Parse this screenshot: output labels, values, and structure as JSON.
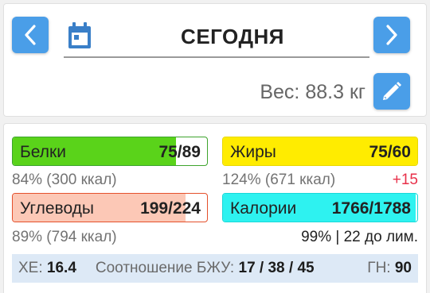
{
  "header": {
    "date_title": "СЕГОДНЯ",
    "weight_label": "Вес:",
    "weight_value": "88.3",
    "weight_unit": "кг"
  },
  "macros": {
    "protein": {
      "name": "Белки",
      "value": "75/89",
      "progress": 0.84,
      "percent_text": "84% (300 ккал)"
    },
    "fat": {
      "name": "Жиры",
      "value": "75/60",
      "progress": 1.0,
      "percent_text": "124% (671 ккал)",
      "over_text": "+15"
    },
    "carbs": {
      "name": "Углеводы",
      "value": "199/224",
      "progress": 0.89,
      "percent_text": "89% (794 ккал)"
    },
    "calories": {
      "name": "Калории",
      "value": "1766/1788",
      "progress": 0.99,
      "percent_text": "99% | 22 до лим."
    }
  },
  "summary": {
    "xe_label": "ХЕ:",
    "xe_value": "16.4",
    "ratio_label": "Соотношение БЖУ:",
    "ratio_value": "17 / 38 / 45",
    "gn_label": "ГН:",
    "gn_value": "90"
  },
  "icons": {
    "prev": "chevron-left-icon",
    "next": "chevron-right-icon",
    "calendar": "calendar-icon",
    "edit": "pencil-icon"
  },
  "colors": {
    "accent": "#4a9ee8",
    "protein": "#5ad31a",
    "fat": "#ffec00",
    "carbs": "#fcc8b6",
    "calories": "#2ef2f0",
    "over": "#e8304a"
  }
}
